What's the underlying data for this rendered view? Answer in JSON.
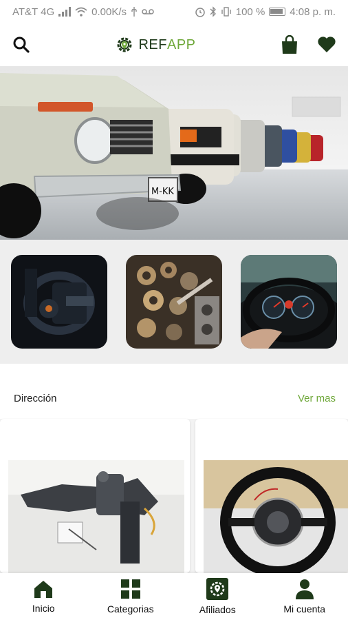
{
  "status_bar": {
    "carrier": "AT&T 4G",
    "speed": "0.00K/s",
    "battery": "100 %",
    "time": "4:08 p. m."
  },
  "app_bar": {
    "logo_ref": "REF",
    "logo_app": "APP",
    "search_icon": "search-icon",
    "bag_icon": "shopping-bag-icon",
    "heart_icon": "heart-icon"
  },
  "hero": {
    "plate_text": "M-KK"
  },
  "categories": [
    {
      "icon": "steering-column-image"
    },
    {
      "icon": "engine-image"
    },
    {
      "icon": "dashboard-image"
    }
  ],
  "section": {
    "title": "Dirección",
    "see_more": "Ver mas"
  },
  "products": [
    {
      "image": "steering-column-part"
    },
    {
      "image": "steering-wheel-part"
    }
  ],
  "bottom_nav": [
    {
      "label": "Inicio",
      "icon": "home-icon"
    },
    {
      "label": "Categorias",
      "icon": "grid-icon"
    },
    {
      "label": "Afiliados",
      "icon": "affiliate-gear-icon"
    },
    {
      "label": "Mi cuenta",
      "icon": "user-icon"
    }
  ],
  "colors": {
    "primary_dark": "#1f3a1a",
    "accent_green": "#6fa83a"
  }
}
